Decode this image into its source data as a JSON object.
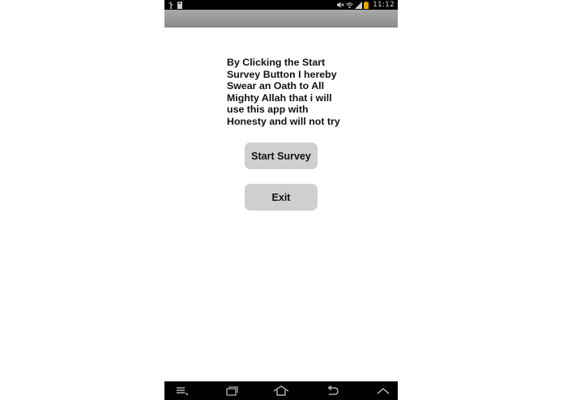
{
  "status_bar": {
    "time": "11:12",
    "left_icons": [
      "usb-icon",
      "sd-card-icon"
    ],
    "right_icons": [
      "mute-icon",
      "wifi-icon",
      "signal-icon",
      "battery-icon"
    ]
  },
  "main": {
    "oath_text": "By Clicking the Start\nSurvey Button I hereby\nSwear an Oath to All\nMighty Allah that i will\nuse this app with\nHonesty and will not try",
    "start_button_label": "Start Survey",
    "exit_button_label": "Exit"
  },
  "nav_bar": {
    "buttons": [
      "menu-icon",
      "recent-apps-icon",
      "home-icon",
      "back-icon",
      "up-icon"
    ]
  },
  "colors": {
    "status_bar": "#000000",
    "action_bar": "#9a9a9a",
    "button_bg": "#cfcfcf",
    "text": "#111111"
  }
}
